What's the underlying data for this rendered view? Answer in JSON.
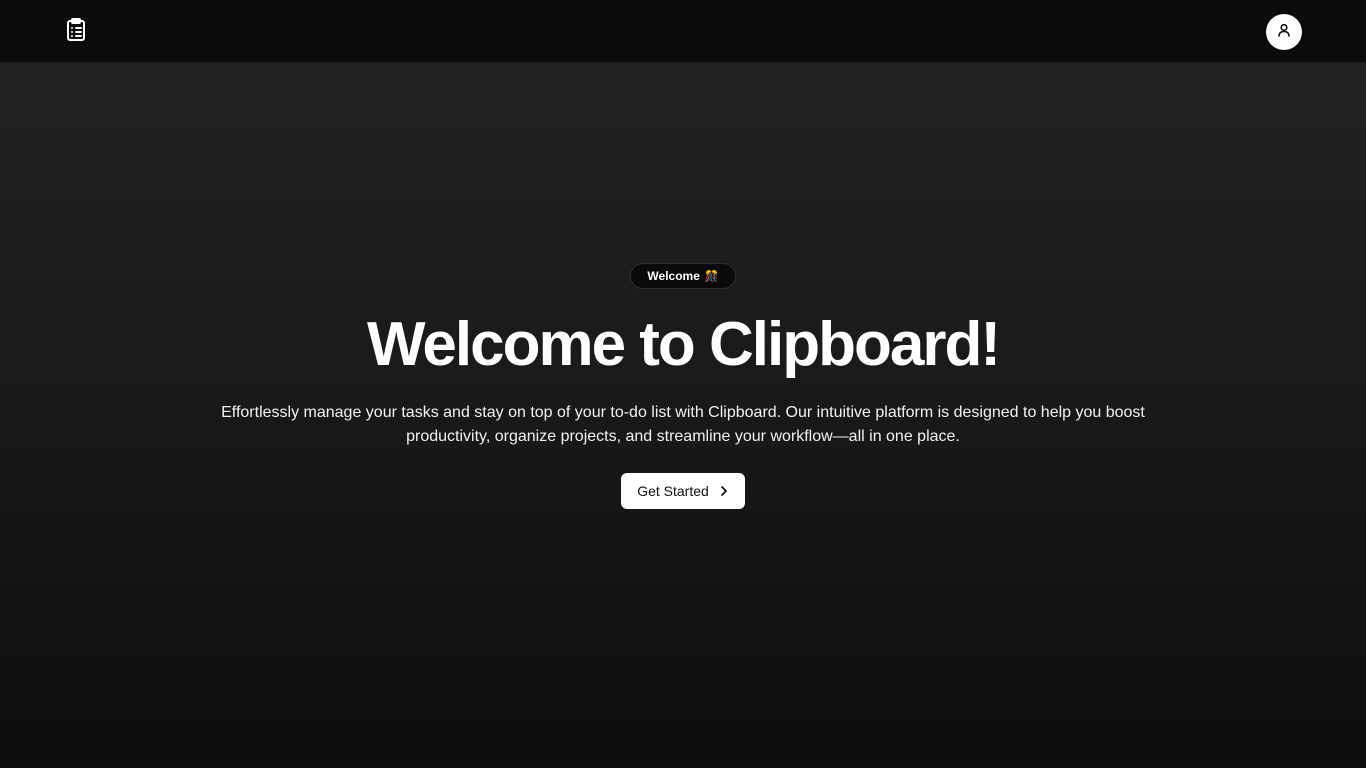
{
  "header": {
    "logo_icon": "clipboard-list-icon",
    "avatar_icon": "user-icon"
  },
  "hero": {
    "badge_label": "Welcome",
    "badge_emoji": "🎊",
    "title": "Welcome to Clipboard!",
    "description": "Effortlessly manage your tasks and stay on top of your to-do list with Clipboard. Our intuitive platform is designed to help you boost productivity, organize projects, and streamline your workflow—all in one place.",
    "cta_label": "Get Started",
    "cta_icon": "chevron-right-icon"
  },
  "colors": {
    "background": "#1c1c1c",
    "topbar": "#0b0b0b",
    "button_bg": "#ffffff",
    "button_text": "#111111"
  }
}
